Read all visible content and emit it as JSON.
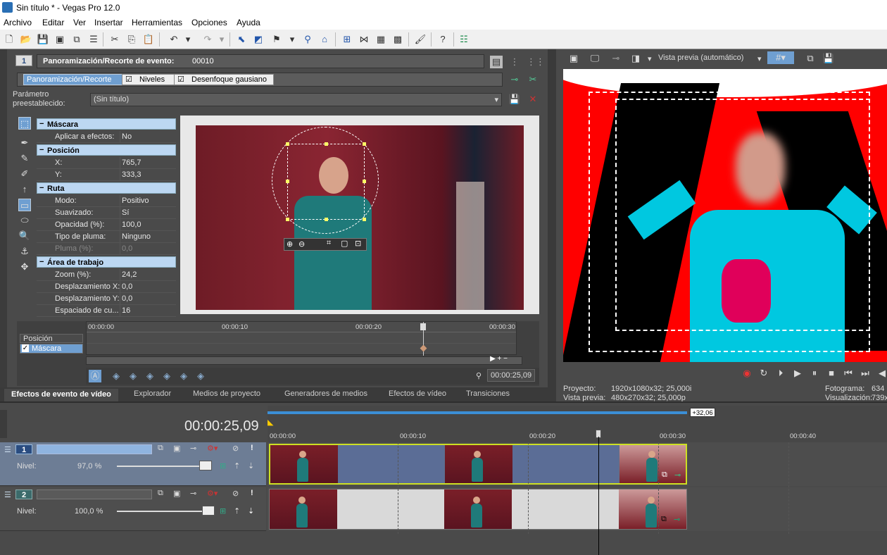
{
  "window": {
    "title": "Sin título * - Vegas Pro 12.0"
  },
  "menu": [
    "Archivo",
    "Editar",
    "Ver",
    "Insertar",
    "Herramientas",
    "Opciones",
    "Ayuda"
  ],
  "event_fx": {
    "header_label": "Panoramización/Recorte de evento:",
    "event_id": "00010",
    "track_num": "1",
    "chain": [
      "Panoramización/Recorte",
      "Niveles",
      "Desenfoque gausiano"
    ],
    "preset_label": "Parámetro preestablecido:",
    "preset_value": "(Sin título)"
  },
  "props": {
    "mask": {
      "title": "Máscara",
      "apply_label": "Aplicar a efectos:",
      "apply_value": "No"
    },
    "position": {
      "title": "Posición",
      "x_label": "X:",
      "x_value": "765,7",
      "y_label": "Y:",
      "y_value": "333,3"
    },
    "path": {
      "title": "Ruta",
      "mode_label": "Modo:",
      "mode_value": "Positivo",
      "smooth_label": "Suavizado:",
      "smooth_value": "Sí",
      "opacity_label": "Opacidad (%):",
      "opacity_value": "100,0",
      "pen_type_label": "Tipo de pluma:",
      "pen_type_value": "Ninguno",
      "pen_label": "Pluma (%):",
      "pen_value": "0,0"
    },
    "workspace": {
      "title": "Área de trabajo",
      "zoom_label": "Zoom (%):",
      "zoom_value": "24,2",
      "dx_label": "Desplazamiento X:",
      "dx_value": "0,0",
      "dy_label": "Desplazamiento Y:",
      "dy_value": "0,0",
      "spacing_label": "Espaciado de cu...",
      "spacing_value": "16"
    }
  },
  "keyframe": {
    "rows": [
      "Posición",
      "Máscara"
    ],
    "ruler": [
      "00:00:00",
      "00:00:10",
      "00:00:20",
      "00:00:30"
    ],
    "time": "00:00:25,09"
  },
  "bottom_tabs": [
    "Efectos de evento de vídeo",
    "Explorador",
    "Medios de proyecto",
    "Generadores de medios",
    "Efectos de vídeo",
    "Transiciones"
  ],
  "preview": {
    "mode": "Vista previa (automático)",
    "project_label": "Proyecto:",
    "project_value": "1920x1080x32; 25,000i",
    "preview_label": "Vista previa:",
    "preview_value": "480x270x32; 25,000p",
    "frame_label": "Fotograma:",
    "frame_value": "634",
    "display_label": "Visualización:",
    "display_value": "739x"
  },
  "timeline": {
    "timecode": "00:00:25,09",
    "ruler": [
      "00:00:00",
      "00:00:10",
      "00:00:20",
      "00:00:30",
      "00:00:40"
    ],
    "loop_end": "+32,06",
    "tracks": [
      {
        "num": "1",
        "level_label": "Nivel:",
        "level_value": "97,0 %",
        "level_fraction": 0.97
      },
      {
        "num": "2",
        "level_label": "Nivel:",
        "level_value": "100,0 %",
        "level_fraction": 1.0
      }
    ]
  },
  "colors": {
    "accent": "#3b8fd6",
    "header_blue": "#bcd7f2",
    "track_selected": "#6d7d95",
    "preview_red": "#ff0000",
    "preview_cyan": "#00c8e0"
  }
}
